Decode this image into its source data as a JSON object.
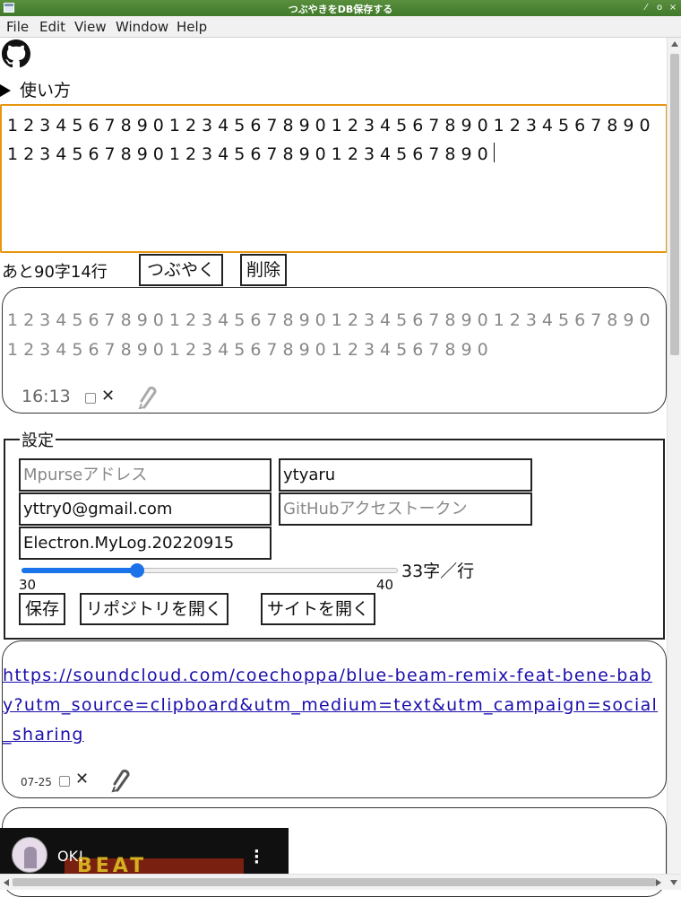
{
  "window": {
    "title": "つぶやきをDB保存する",
    "buttons": [
      "⁄",
      "o",
      "×"
    ]
  },
  "menu": {
    "file": "File",
    "edit": "Edit",
    "view": "View",
    "window": "Window",
    "help": "Help"
  },
  "help_toggle": "使い方",
  "editor": {
    "value": "1234567890123456789012345678901234567890123456789012345678901234567890"
  },
  "counter": "あと90字14行",
  "buttons": {
    "tweet": "つぶやく",
    "delete": "削除"
  },
  "posts": [
    {
      "text": "1234567890123456789012345678901234567890123456789012345678901234567890",
      "time": "16:13",
      "close": "✕"
    },
    {
      "link": "https://soundcloud.com/coechoppa/blue-beam-remix-feat-bene-baby?utm_source=clipboard&utm_medium=text&utm_campaign=social_sharing",
      "time": "07-25",
      "close": "✕"
    }
  ],
  "settings": {
    "legend": "設定",
    "mpurse_placeholder": "Mpurseアドレス",
    "username": "ytyaru",
    "email": "yttry0@gmail.com",
    "token_placeholder": "GitHubアクセストークン",
    "repo": "Electron.MyLog.20220915",
    "slider": {
      "min": "30",
      "max": "40",
      "value": 33,
      "label": "33字／行"
    },
    "save": "保存",
    "open_repo": "リポジトリを開く",
    "open_site": "サイトを開く"
  },
  "video": {
    "title": "OK!",
    "thumb_text": "BEAT"
  }
}
